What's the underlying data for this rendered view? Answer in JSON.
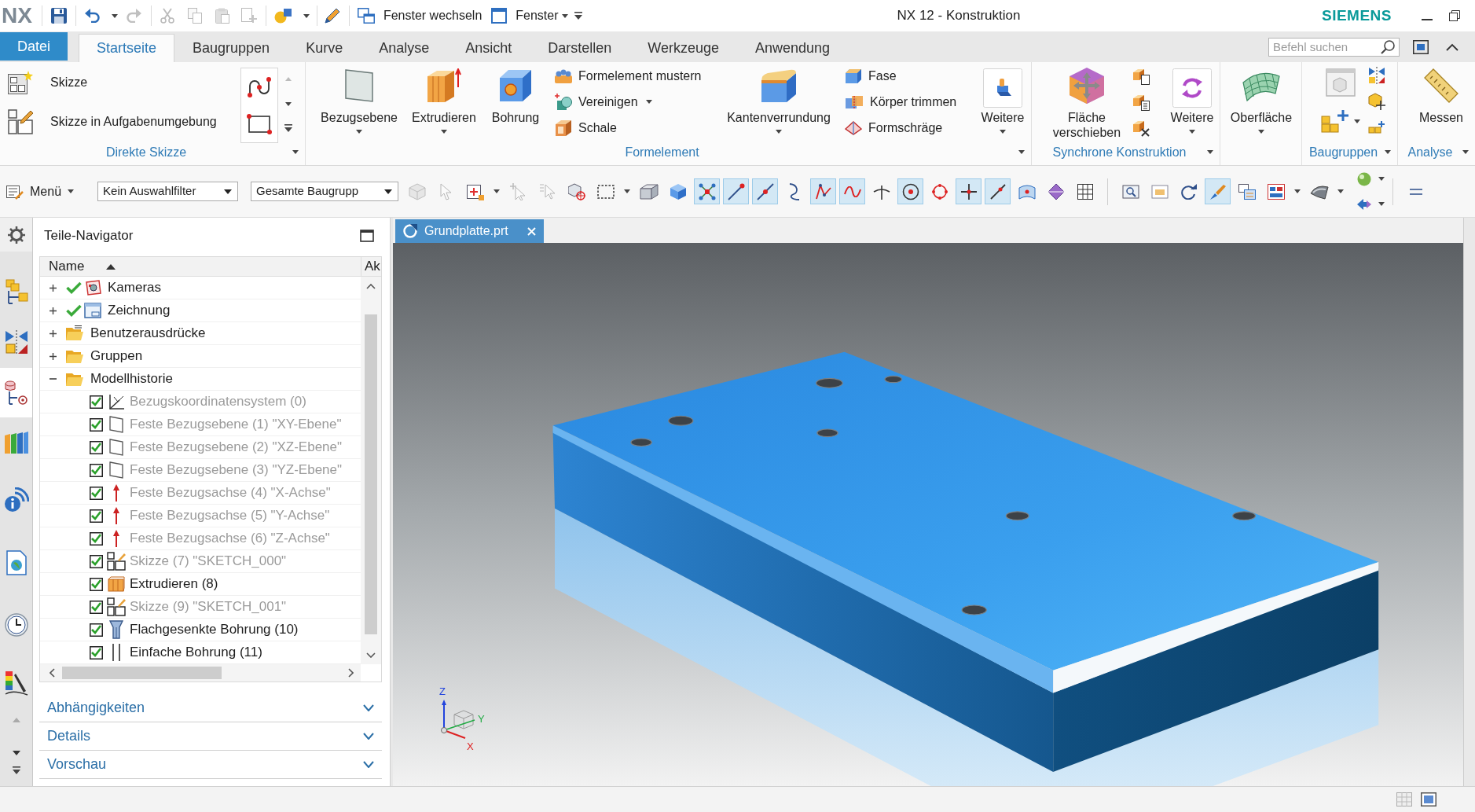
{
  "window": {
    "logo": "NX",
    "title": "NX 12 - Konstruktion",
    "brand": "SIEMENS"
  },
  "quick_access": [
    {
      "kind": "icon",
      "disabled": false,
      "has_menu": false
    },
    {
      "kind": "icon",
      "disabled": false,
      "has_menu": true
    },
    {
      "kind": "icon",
      "disabled": true,
      "has_menu": false
    },
    {
      "kind": "icon",
      "disabled": true,
      "has_menu": false
    },
    {
      "kind": "icon",
      "disabled": true,
      "has_menu": false
    },
    {
      "kind": "icon",
      "disabled": true,
      "has_menu": false
    },
    {
      "kind": "icon",
      "disabled": true,
      "has_menu": false
    },
    {
      "kind": "icon",
      "disabled": false,
      "has_menu": true
    },
    {
      "kind": "icon",
      "disabled": false,
      "has_menu": false
    },
    {
      "kind": "labelled",
      "label": "Fenster wechseln",
      "has_menu": false
    },
    {
      "kind": "labelled",
      "label": "Fenster",
      "has_menu": true
    },
    {
      "kind": "customize"
    }
  ],
  "ribbon_tabs": [
    {
      "label": "Datei",
      "kind": "file",
      "selected": false
    },
    {
      "label": "Startseite",
      "kind": "tab",
      "selected": true
    },
    {
      "label": "Baugruppen",
      "kind": "tab",
      "selected": false
    },
    {
      "label": "Kurve",
      "kind": "tab",
      "selected": false
    },
    {
      "label": "Analyse",
      "kind": "tab",
      "selected": false
    },
    {
      "label": "Ansicht",
      "kind": "tab",
      "selected": false
    },
    {
      "label": "Darstellen",
      "kind": "tab",
      "selected": false
    },
    {
      "label": "Werkzeuge",
      "kind": "tab",
      "selected": false
    },
    {
      "label": "Anwendung",
      "kind": "tab",
      "selected": false
    }
  ],
  "command_search": {
    "placeholder": "Befehl suchen"
  },
  "ribbon": {
    "groups": [
      {
        "label": "Direkte Skizze",
        "has_menu": true,
        "items": [
          {
            "kind": "stack",
            "commands": [
              {
                "label": "Skizze",
                "has_menu": false
              },
              {
                "label": "Skizze in Aufgabenumgebung",
                "has_menu": false
              }
            ]
          },
          {
            "kind": "gallery"
          }
        ]
      },
      {
        "label": "Formelement",
        "has_menu": true,
        "items": [
          {
            "kind": "large",
            "label": "Bezugsebene",
            "has_menu": true
          },
          {
            "kind": "large",
            "label": "Extrudieren",
            "has_menu": true
          },
          {
            "kind": "large",
            "label": "Bohrung",
            "has_menu": false
          },
          {
            "kind": "stack",
            "commands": [
              {
                "label": "Formelement mustern",
                "has_menu": false
              },
              {
                "label": "Vereinigen",
                "has_menu": true
              },
              {
                "label": "Schale",
                "has_menu": false
              }
            ]
          },
          {
            "kind": "large",
            "label": "Kantenverrundung",
            "has_menu": true
          },
          {
            "kind": "stack",
            "commands": [
              {
                "label": "Fase",
                "has_menu": false
              },
              {
                "label": "Körper trimmen",
                "has_menu": false
              },
              {
                "label": "Formschräge",
                "has_menu": false
              }
            ]
          },
          {
            "kind": "more",
            "label": "Weitere",
            "has_menu": true
          }
        ]
      },
      {
        "label": "Synchrone Konstruktion",
        "has_menu": true,
        "items": [
          {
            "kind": "large",
            "label": "Fläche verschieben",
            "has_menu": false
          },
          {
            "kind": "icon_stack"
          },
          {
            "kind": "more",
            "label": "Weitere",
            "has_menu": true
          }
        ]
      },
      {
        "has_menu": false,
        "items": [
          {
            "kind": "large",
            "label": "Oberfläche",
            "has_menu": true
          }
        ]
      },
      {
        "label": "Baugruppen",
        "has_menu": true,
        "items": [
          {
            "kind": "assembly_cluster"
          }
        ]
      },
      {
        "label": "Analyse",
        "has_menu": true,
        "items": [
          {
            "kind": "large",
            "label": "Messen",
            "has_menu": false
          }
        ]
      }
    ]
  },
  "selection_bar": {
    "menu": {
      "label": "Menü",
      "has_menu": true
    },
    "filters": [
      {
        "value": "Kein Auswahlfilter"
      },
      {
        "value": "Gesamte Baugrupp"
      }
    ],
    "tools": [
      {
        "kind": "tool",
        "on": false,
        "disabled": true,
        "has_menu": false
      },
      {
        "kind": "tool",
        "on": false,
        "disabled": true,
        "has_menu": false
      },
      {
        "kind": "tool",
        "on": false,
        "disabled": false,
        "has_menu": true
      },
      {
        "kind": "tool",
        "on": false,
        "disabled": true,
        "has_menu": false
      },
      {
        "kind": "tool",
        "on": false,
        "disabled": true,
        "has_menu": false
      },
      {
        "kind": "tool",
        "on": false,
        "disabled": false,
        "has_menu": false
      },
      {
        "kind": "tool",
        "on": false,
        "disabled": false,
        "has_menu": true
      },
      {
        "kind": "tool",
        "on": false,
        "disabled": false,
        "has_menu": false
      },
      {
        "kind": "tool",
        "on": false,
        "disabled": false,
        "has_menu": false
      },
      {
        "kind": "tool",
        "on": true,
        "disabled": false,
        "has_menu": false
      },
      {
        "kind": "tool",
        "on": true,
        "disabled": false,
        "has_menu": false
      },
      {
        "kind": "tool",
        "on": true,
        "disabled": false,
        "has_menu": false
      },
      {
        "kind": "tool",
        "on": false,
        "disabled": false,
        "has_menu": false
      },
      {
        "kind": "tool",
        "on": true,
        "disabled": false,
        "has_menu": false
      },
      {
        "kind": "tool",
        "on": true,
        "disabled": false,
        "has_menu": false
      },
      {
        "kind": "tool",
        "on": false,
        "disabled": false,
        "has_menu": false
      },
      {
        "kind": "tool",
        "on": true,
        "disabled": false,
        "has_menu": false
      },
      {
        "kind": "tool",
        "on": false,
        "disabled": false,
        "has_menu": false
      },
      {
        "kind": "tool",
        "on": true,
        "disabled": false,
        "has_menu": false
      },
      {
        "kind": "tool",
        "on": true,
        "disabled": false,
        "has_menu": false
      },
      {
        "kind": "tool",
        "on": false,
        "disabled": false,
        "has_menu": false
      },
      {
        "kind": "tool",
        "on": false,
        "disabled": false,
        "has_menu": false
      },
      {
        "kind": "tool",
        "on": false,
        "disabled": false,
        "has_menu": false
      },
      {
        "kind": "separator"
      },
      {
        "kind": "tool",
        "on": false,
        "disabled": false,
        "has_menu": false
      },
      {
        "kind": "tool",
        "on": false,
        "disabled": false,
        "has_menu": false
      },
      {
        "kind": "tool",
        "on": false,
        "disabled": false,
        "has_menu": false
      },
      {
        "kind": "tool",
        "on": true,
        "disabled": false,
        "has_menu": false
      },
      {
        "kind": "tool",
        "on": false,
        "disabled": false,
        "has_menu": false
      },
      {
        "kind": "tool",
        "on": false,
        "disabled": false,
        "has_menu": true
      },
      {
        "kind": "tool",
        "on": false,
        "disabled": false,
        "has_menu": true
      },
      {
        "kind": "pair",
        "tools": [
          {
            "on": false,
            "disabled": false,
            "has_menu": true
          },
          {
            "on": false,
            "disabled": false,
            "has_menu": true
          }
        ]
      },
      {
        "kind": "separator"
      },
      {
        "kind": "tool",
        "on": false,
        "disabled": false,
        "has_menu": false
      }
    ]
  },
  "resource_bar": [
    {
      "selected": false
    },
    {
      "selected": false
    },
    {
      "selected": true
    },
    {
      "selected": false
    },
    {
      "selected": false
    },
    {
      "selected": false
    },
    {
      "selected": false
    },
    {
      "selected": false
    }
  ],
  "navigator": {
    "title": "Teile-Navigator",
    "columns": [
      {
        "label": "Name",
        "sorted": true
      },
      {
        "label": "Ak",
        "sorted": false
      }
    ],
    "tree": [
      {
        "label": "Kameras",
        "expanded": false,
        "checked": true
      },
      {
        "label": "Zeichnung",
        "expanded": false,
        "checked": true
      },
      {
        "label": "Benutzerausdrücke",
        "expanded": false,
        "checked": false
      },
      {
        "label": "Gruppen",
        "expanded": false,
        "checked": false
      },
      {
        "label": "Modellhistorie",
        "expanded": true,
        "checked": false,
        "children": [
          {
            "label": "Bezugskoordinatensystem (0)",
            "checked": true,
            "dimmed": true
          },
          {
            "label": "Feste Bezugsebene (1) \"XY-Ebene\"",
            "checked": true,
            "dimmed": true
          },
          {
            "label": "Feste Bezugsebene (2) \"XZ-Ebene\"",
            "checked": true,
            "dimmed": true
          },
          {
            "label": "Feste Bezugsebene (3) \"YZ-Ebene\"",
            "checked": true,
            "dimmed": true
          },
          {
            "label": "Feste Bezugsachse (4) \"X-Achse\"",
            "checked": true,
            "dimmed": true
          },
          {
            "label": "Feste Bezugsachse (5) \"Y-Achse\"",
            "checked": true,
            "dimmed": true
          },
          {
            "label": "Feste Bezugsachse (6) \"Z-Achse\"",
            "checked": true,
            "dimmed": true
          },
          {
            "label": "Skizze (7) \"SKETCH_000\"",
            "checked": true,
            "dimmed": true
          },
          {
            "label": "Extrudieren (8)",
            "checked": true,
            "dimmed": false
          },
          {
            "label": "Skizze (9) \"SKETCH_001\"",
            "checked": true,
            "dimmed": true
          },
          {
            "label": "Flachgesenkte Bohrung (10)",
            "checked": true,
            "dimmed": false
          },
          {
            "label": "Einfache Bohrung (11)",
            "checked": true,
            "dimmed": false
          }
        ]
      }
    ],
    "panels": [
      {
        "label": "Abhängigkeiten",
        "expanded": false
      },
      {
        "label": "Details",
        "expanded": false
      },
      {
        "label": "Vorschau",
        "expanded": false
      }
    ]
  },
  "viewport": {
    "tabs": [
      {
        "label": "Grundplatte.prt",
        "selected": true
      }
    ],
    "axis_labels": [
      "Z",
      "Y",
      "X"
    ]
  }
}
